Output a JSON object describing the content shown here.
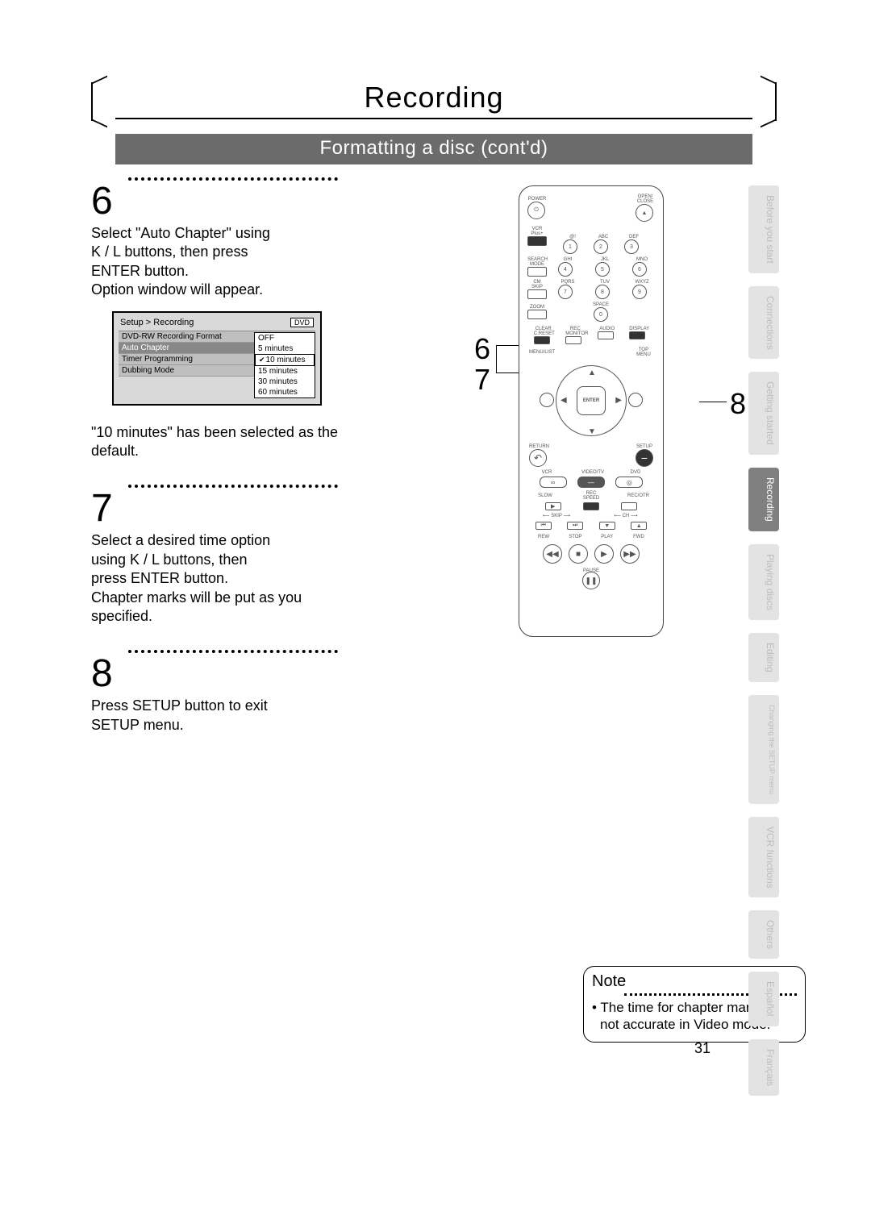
{
  "header": {
    "title": "Recording",
    "subtitle": "Formatting a disc (cont'd)"
  },
  "steps": {
    "s6": {
      "num": "6",
      "text_a": "Select \"Auto Chapter\" using",
      "text_b": "K / L buttons, then press",
      "text_c": "ENTER button.",
      "text_d": "Option window will appear."
    },
    "s7": {
      "num": "7",
      "text_a": "Select a desired time option",
      "text_b": "using K / L buttons, then",
      "text_c": "press ENTER button.",
      "text_d": "Chapter marks will be put as you",
      "text_e": "specified."
    },
    "s8": {
      "num": "8",
      "text_a": "Press SETUP button to exit",
      "text_b": "SETUP menu."
    },
    "default_note": "\"10 minutes\" has been selected as the default."
  },
  "osd": {
    "breadcrumb": "Setup > Recording",
    "dvd_badge": "DVD",
    "items": [
      "DVD-RW Recording Format",
      "Auto Chapter",
      "Timer Programming",
      "Dubbing Mode"
    ],
    "options": [
      "OFF",
      "5 minutes",
      "10 minutes",
      "15 minutes",
      "30 minutes",
      "60 minutes"
    ],
    "selected_index": 2
  },
  "remote": {
    "labels": {
      "power": "POWER",
      "open_close": "OPEN/\nCLOSE",
      "vcrplus": "VCR Plus+",
      "search": "SEARCH\nMODE",
      "cmskip": "CM SKIP",
      "zoom": "ZOOM",
      "clear": "CLEAR\nC.RESET",
      "rec_monitor": "REC\nMONITOR",
      "audio": "AUDIO",
      "display": "DISPLAY",
      "menulist": "MENU/LIST",
      "topmenu": "TOP MENU",
      "enter": "ENTER",
      "return": "RETURN",
      "setup": "SETUP",
      "vcr": "VCR",
      "videotv": "VIDEO/TV",
      "dvd": "DVD",
      "slow": "SLOW",
      "recspeed": "REC\nSPEED",
      "recotr": "REC/OTR",
      "skip": "SKIP",
      "ch": "CH",
      "rew": "REW",
      "stop": "STOP",
      "play": "PLAY",
      "fwd": "FWD",
      "pause": "PAUSE",
      "space": "SPACE",
      "abc": "ABC",
      "def": "DEF",
      "at": "@!",
      "ghi": "GHI",
      "jkl": "JKL",
      "mno": "MNO",
      "pqrs": "PQRS",
      "tuv": "TUV",
      "wxyz": "WXYZ"
    },
    "digits": [
      "1",
      "2",
      "3",
      "4",
      "5",
      "6",
      "7",
      "8",
      "9",
      "0"
    ]
  },
  "callouts": {
    "left1": "6",
    "left2": "7",
    "right": "8"
  },
  "note": {
    "heading": "Note",
    "bullet": "The time for chapter marks is not accurate in Video mode."
  },
  "tabs": [
    {
      "label": "Before you start",
      "active": false
    },
    {
      "label": "Connections",
      "active": false
    },
    {
      "label": "Getting started",
      "active": false
    },
    {
      "label": "Recording",
      "active": true
    },
    {
      "label": "Playing discs",
      "active": false
    },
    {
      "label": "Editing",
      "active": false
    },
    {
      "label": "Changing the SETUP menu",
      "active": false,
      "small": true
    },
    {
      "label": "VCR functions",
      "active": false
    },
    {
      "label": "Others",
      "active": false
    },
    {
      "label": "Español",
      "active": false
    },
    {
      "label": "Français",
      "active": false
    }
  ],
  "page_number": "31"
}
